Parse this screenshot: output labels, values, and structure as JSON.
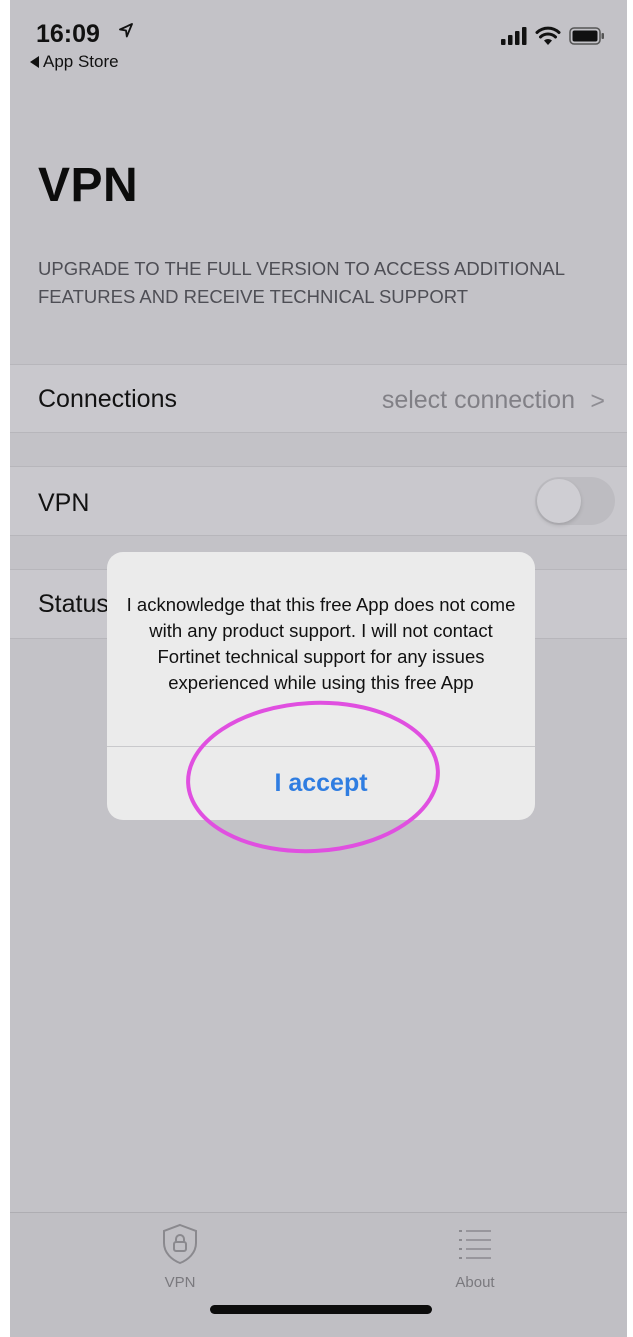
{
  "status_bar": {
    "time": "16:09",
    "back_label": "App Store"
  },
  "page": {
    "title": "VPN",
    "upgrade_notice": "UPGRADE TO THE FULL VERSION TO ACCESS ADDITIONAL FEATURES AND RECEIVE TECHNICAL SUPPORT"
  },
  "rows": {
    "connections_label": "Connections",
    "connections_value": "select connection",
    "chevron": ">",
    "vpn_label": "VPN",
    "vpn_enabled": false,
    "status_label": "Status"
  },
  "alert": {
    "message": "I acknowledge that this free App does not come with any product support. I will not contact Fortinet technical support for any issues experienced while using this free App",
    "accept_label": "I accept"
  },
  "tabs": [
    {
      "label": "VPN",
      "icon": "shield-lock-icon"
    },
    {
      "label": "About",
      "icon": "list-icon"
    }
  ],
  "colors": {
    "accent": "#2f7de1",
    "annotation": "#e04fe0"
  }
}
